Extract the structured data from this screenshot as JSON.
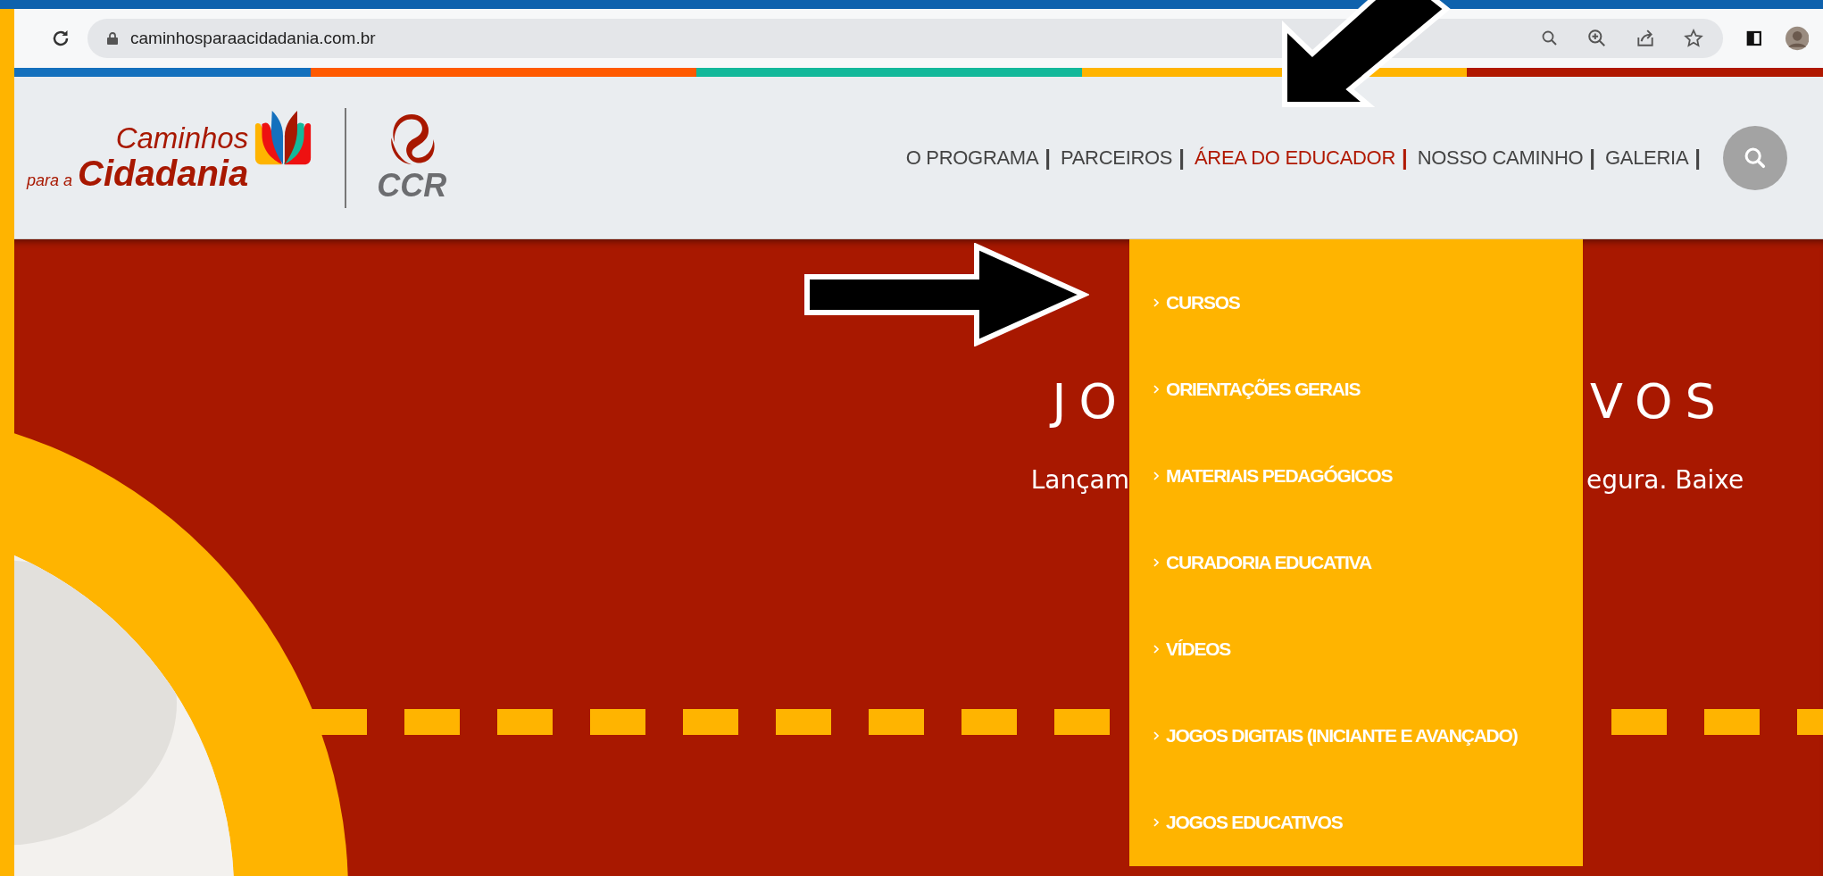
{
  "browser": {
    "url": "caminhosparaacidadania.com.br"
  },
  "logo": {
    "line_1": "Caminhos",
    "line_2_small": "para a",
    "line_2": "Cidadania",
    "partner": "CCR"
  },
  "nav": {
    "items": [
      {
        "label": "O PROGRAMA",
        "separator": "|",
        "selected": false
      },
      {
        "label": "PARCEIROS",
        "separator": "|",
        "selected": false
      },
      {
        "label": "ÁREA DO EDUCADOR",
        "separator": "|",
        "selected": true,
        "submenu": [
          {
            "label": "CURSOS"
          },
          {
            "label": "ORIENTAÇÕES GERAIS"
          },
          {
            "label": "MATERIAIS PEDAGÓGICOS"
          },
          {
            "label": "CURADORIA EDUCATIVA"
          },
          {
            "label": "VÍDEOS"
          },
          {
            "label": "JOGOS DIGITAIS (INICIANTE E AVANÇADO)"
          },
          {
            "label": "JOGOS EDUCATIVOS"
          }
        ]
      },
      {
        "label": "NOSSO CAMINHO",
        "separator": "|",
        "selected": false
      },
      {
        "label": "GALERIA",
        "separator": "|",
        "selected": false
      }
    ]
  },
  "hero": {
    "title_left": "JO",
    "title_right": "VOS",
    "subtitle_left": "Lançam",
    "subtitle_right": "egura. Baixe"
  }
}
